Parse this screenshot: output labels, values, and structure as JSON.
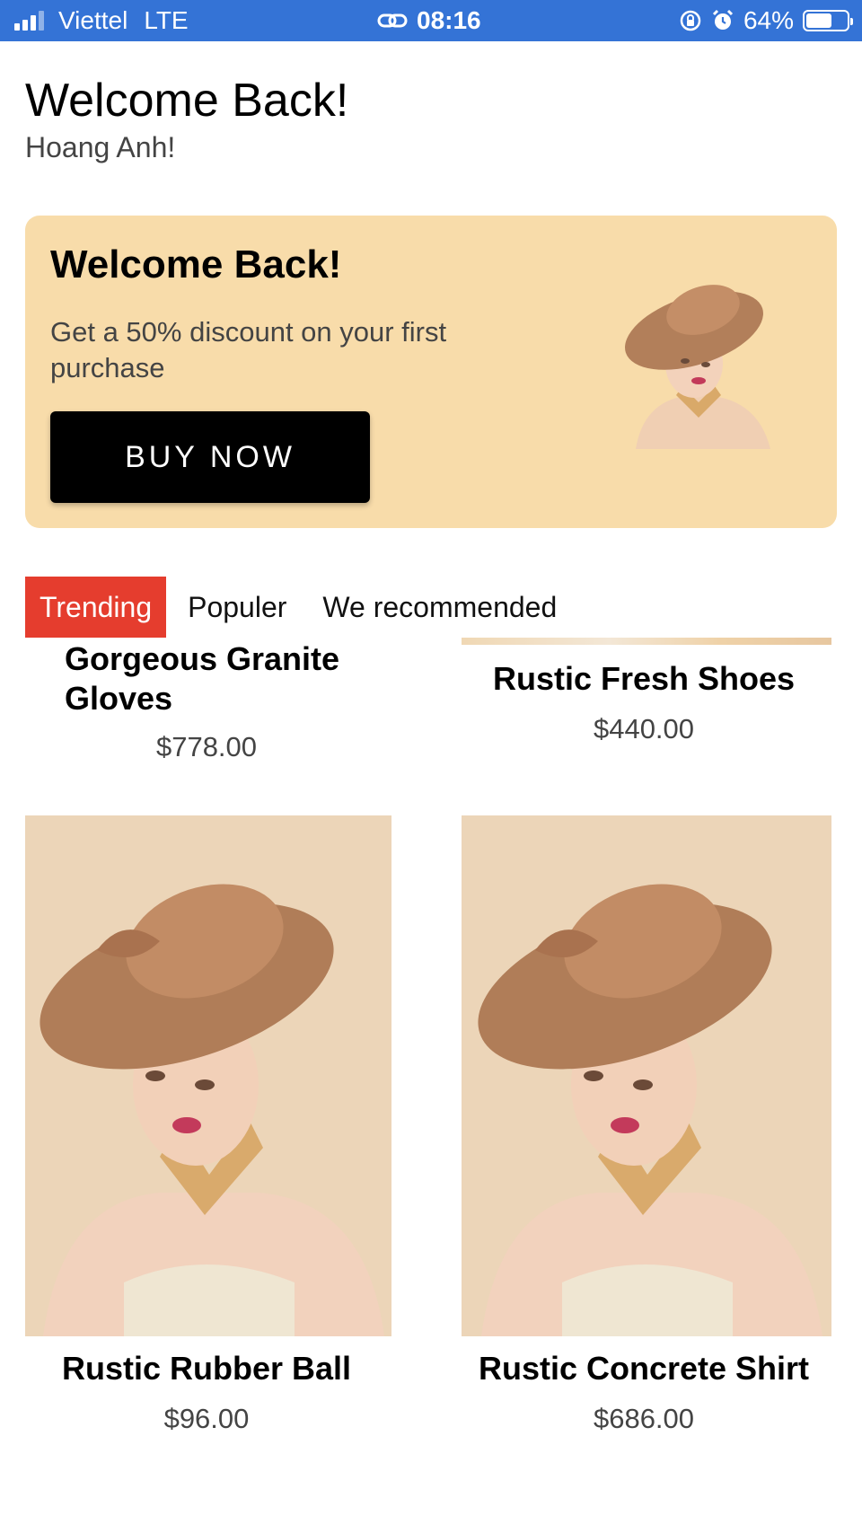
{
  "status_bar": {
    "carrier": "Viettel",
    "network": "LTE",
    "time": "08:16",
    "battery_percent": "64%",
    "battery_level": 0.64,
    "icons": [
      "signal-icon",
      "link-icon",
      "rotation-lock-icon",
      "alarm-icon",
      "battery-icon"
    ]
  },
  "header": {
    "title": "Welcome Back!",
    "username": "Hoang Anh!"
  },
  "banner": {
    "title": "Welcome Back!",
    "text": "Get a 50% discount on your first purchase",
    "button_label": "BUY NOW",
    "background_color": "#f8dcaa"
  },
  "tabs": [
    {
      "label": "Trending",
      "active": true
    },
    {
      "label": "Populer",
      "active": false
    },
    {
      "label": "We recommended",
      "active": false
    }
  ],
  "colors": {
    "status_bar": "#3473d6",
    "active_tab": "#e53d2e",
    "button": "#000000"
  },
  "products": [
    {
      "name": "Gorgeous Granite Gloves",
      "price": "$778.00"
    },
    {
      "name": "Rustic Fresh Shoes",
      "price": "$440.00"
    },
    {
      "name": "Rustic Rubber Ball",
      "price": "$96.00"
    },
    {
      "name": "Rustic Concrete Shirt",
      "price": "$686.00"
    }
  ]
}
